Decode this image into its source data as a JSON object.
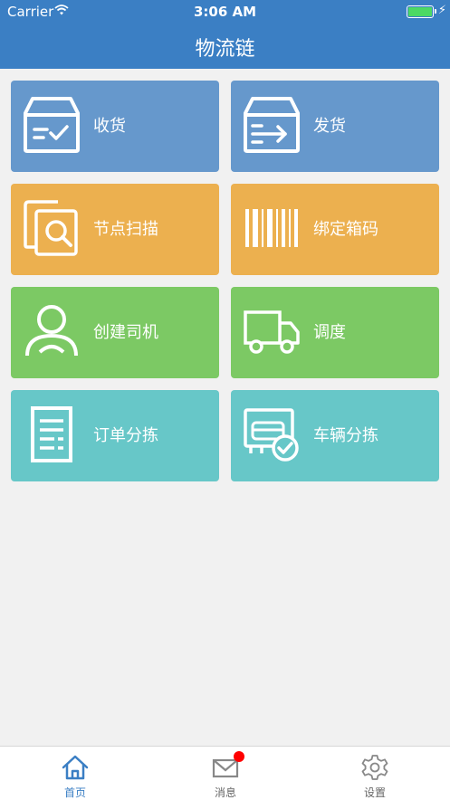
{
  "status_bar": {
    "carrier": "Carrier",
    "time": "3:06 AM"
  },
  "nav": {
    "title": "物流链"
  },
  "tiles": [
    {
      "label": "收货",
      "icon": "receive-box-icon",
      "color": "#6698cc"
    },
    {
      "label": "发货",
      "icon": "ship-box-icon",
      "color": "#6698cc"
    },
    {
      "label": "节点扫描",
      "icon": "document-search-icon",
      "color": "#ecb04f"
    },
    {
      "label": "绑定箱码",
      "icon": "barcode-icon",
      "color": "#ecb04f"
    },
    {
      "label": "创建司机",
      "icon": "driver-user-icon",
      "color": "#7cc964"
    },
    {
      "label": "调度",
      "icon": "truck-icon",
      "color": "#7cc964"
    },
    {
      "label": "订单分拣",
      "icon": "order-list-icon",
      "color": "#67c7c8"
    },
    {
      "label": "车辆分拣",
      "icon": "vehicle-check-icon",
      "color": "#67c7c8"
    }
  ],
  "tabbar": {
    "items": [
      {
        "label": "首页",
        "icon": "home-icon",
        "active": true
      },
      {
        "label": "消息",
        "icon": "mail-icon",
        "badge": true
      },
      {
        "label": "设置",
        "icon": "gear-icon"
      }
    ]
  },
  "colors": {
    "header": "#3b7fc4",
    "active_tab": "#3b7fc4",
    "badge": "#ff0000"
  }
}
